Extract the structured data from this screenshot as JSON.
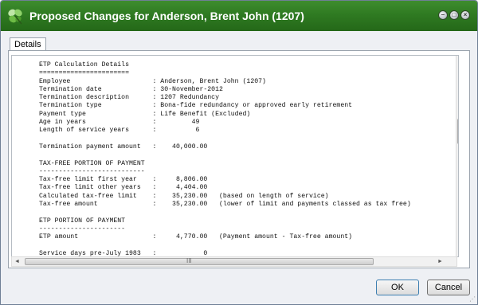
{
  "window": {
    "title": "Proposed Changes for Anderson, Brent John (1207)",
    "brand_color": "#2f7a22"
  },
  "tabs": [
    {
      "label": "Details",
      "selected": true
    }
  ],
  "details": {
    "lines": [
      "ETP Calculation Details",
      "=======================",
      "Employee                     : Anderson, Brent John (1207)",
      "Termination date             : 30-November-2012",
      "Termination description      : 1207 Redundancy",
      "Termination type             : Bona-fide redundancy or approved early retirement",
      "Payment type                 : Life Benefit (Excluded)",
      "Age in years                 :         49",
      "Length of service years      :          6",
      "",
      "Termination payment amount   :    40,000.00",
      "",
      "TAX-FREE PORTION OF PAYMENT",
      "---------------------------",
      "Tax-free limit first year    :     8,806.00",
      "Tax-free limit other years   :     4,404.00",
      "Calculated tax-free limit    :    35,230.00   (based on length of service)",
      "Tax-free amount              :    35,230.00   (lower of limit and payments classed as tax free)",
      "",
      "ETP PORTION OF PAYMENT",
      "----------------------",
      "ETP amount                   :     4,770.00   (Payment amount - Tax-free amount)",
      "",
      "Service days pre-July 1983   :            0"
    ]
  },
  "scrollbars": {
    "vertical_up": "▲",
    "vertical_down": "▼",
    "horizontal_left": "◄",
    "horizontal_right": "►",
    "grip": "III"
  },
  "buttons": {
    "ok_label": "OK",
    "cancel_label": "Cancel"
  }
}
